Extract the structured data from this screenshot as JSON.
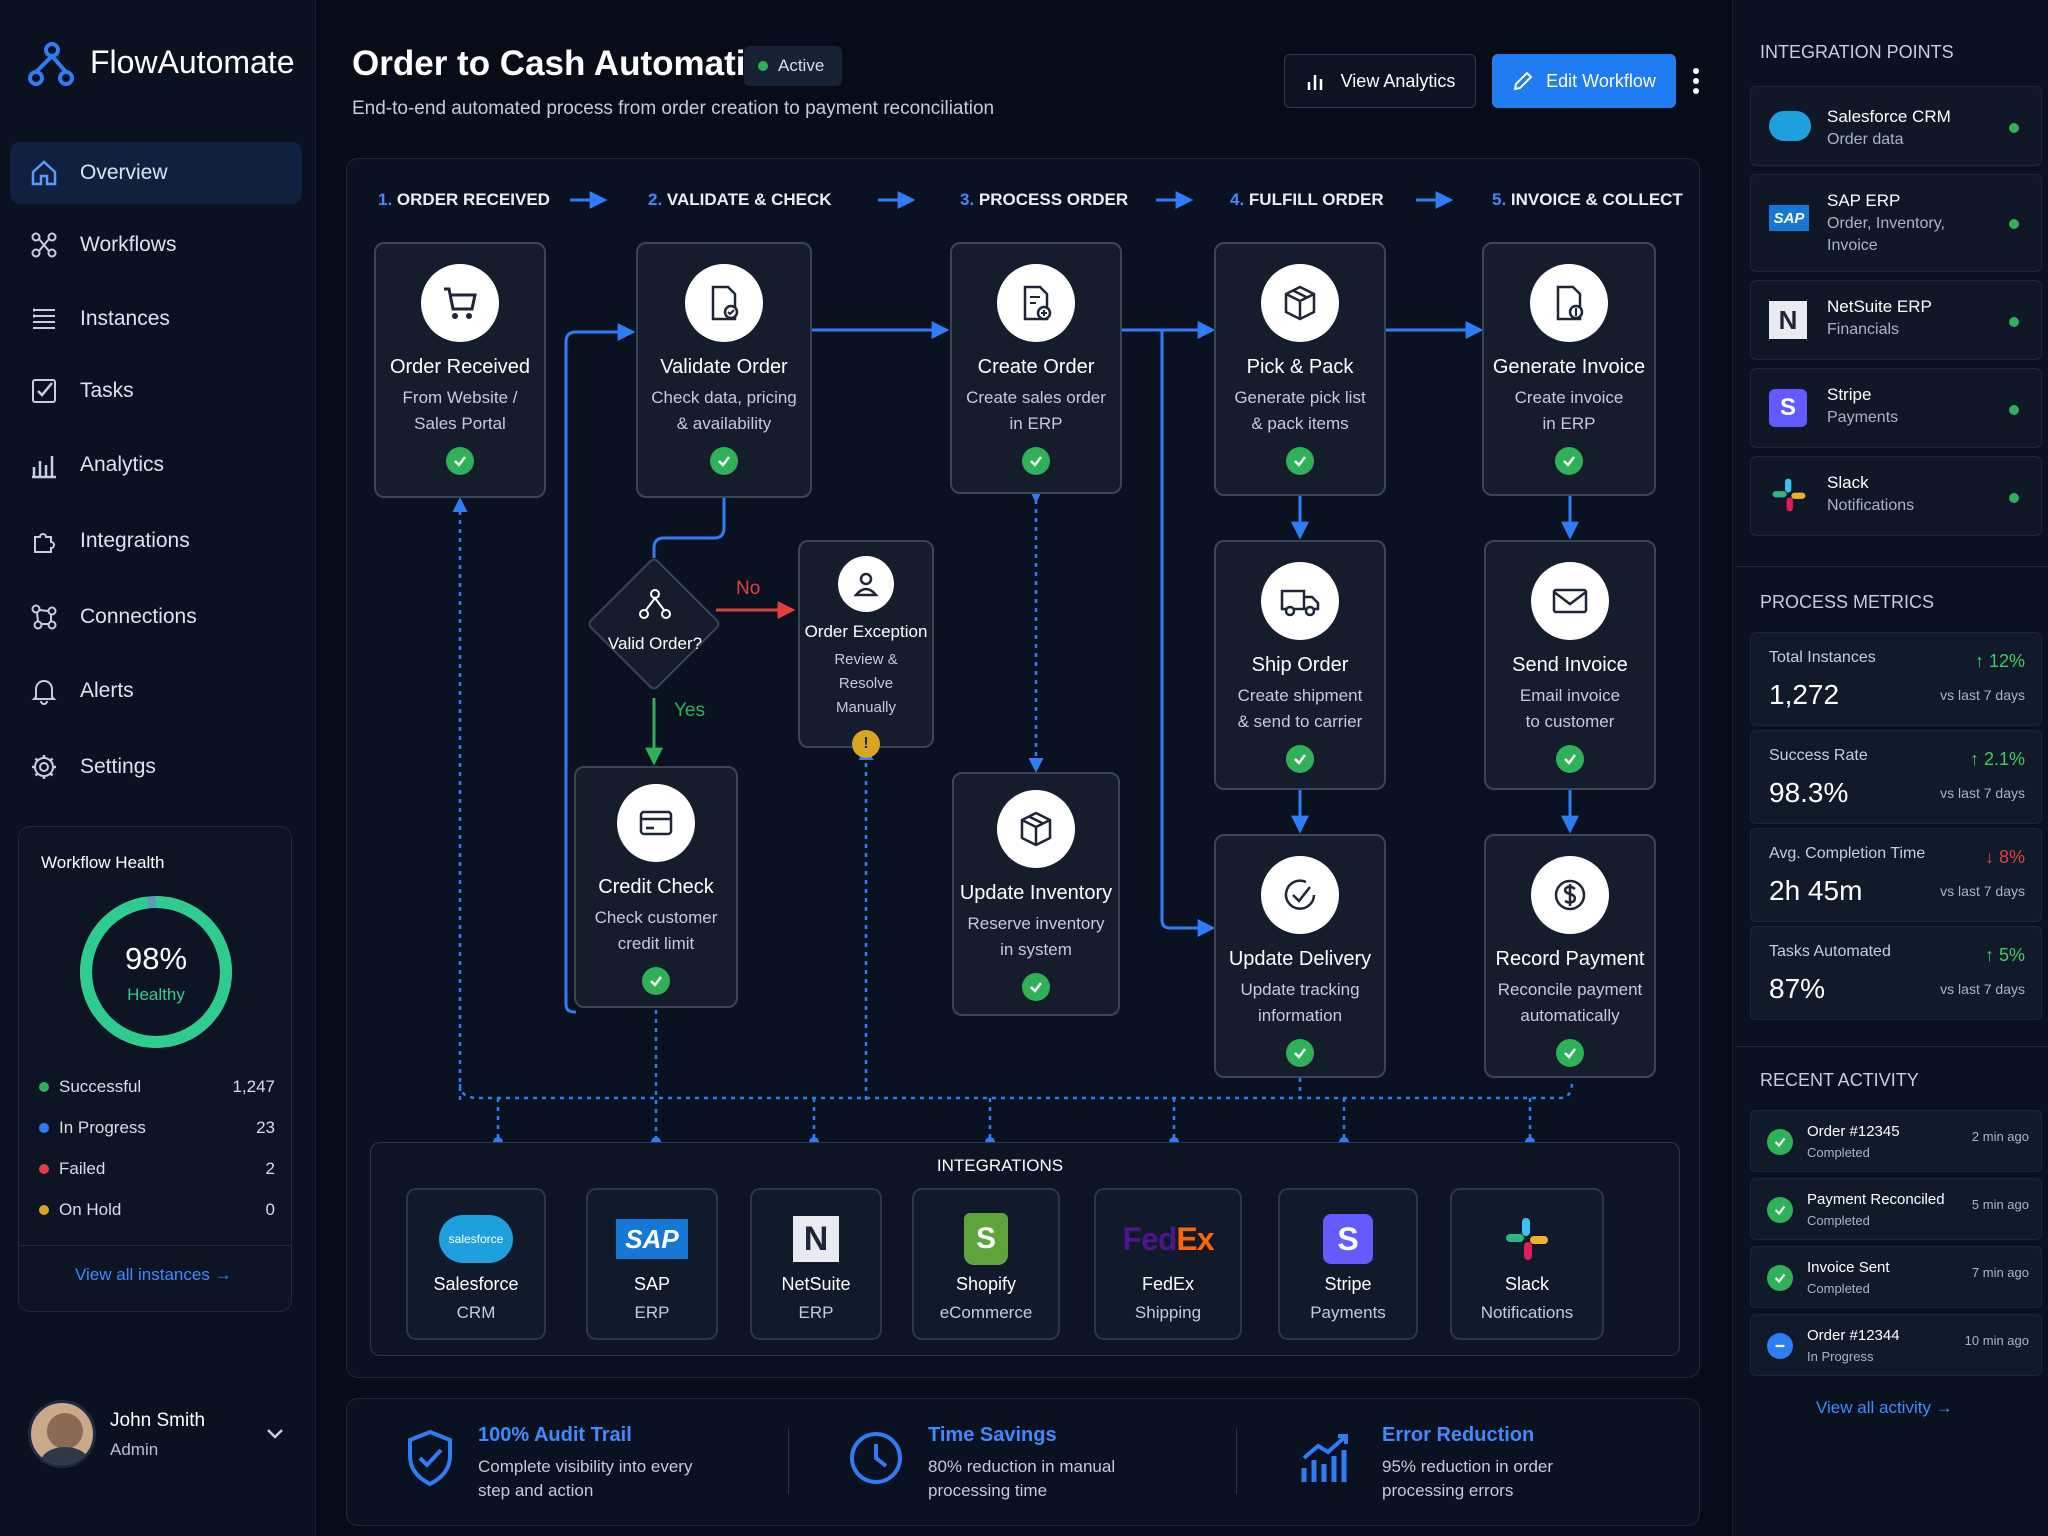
{
  "app": {
    "name": "FlowAutomate"
  },
  "nav": [
    {
      "label": "Overview",
      "icon": "home-icon"
    },
    {
      "label": "Workflows",
      "icon": "workflow-icon"
    },
    {
      "label": "Instances",
      "icon": "list-icon"
    },
    {
      "label": "Tasks",
      "icon": "check-square-icon"
    },
    {
      "label": "Analytics",
      "icon": "bar-chart-icon"
    },
    {
      "label": "Integrations",
      "icon": "puzzle-icon"
    },
    {
      "label": "Connections",
      "icon": "network-icon"
    },
    {
      "label": "Alerts",
      "icon": "bell-icon"
    },
    {
      "label": "Settings",
      "icon": "gear-icon"
    }
  ],
  "health": {
    "title": "Workflow Health",
    "percent_label": "98%",
    "status": "Healthy",
    "percent": 0.98,
    "items": [
      {
        "label": "Successful",
        "value": "1,247",
        "color": "#2fb157"
      },
      {
        "label": "In Progress",
        "value": "23",
        "color": "#2f7df6"
      },
      {
        "label": "Failed",
        "value": "2",
        "color": "#e0413c"
      },
      {
        "label": "On Hold",
        "value": "0",
        "color": "#d9a520"
      }
    ],
    "link": "View all instances"
  },
  "user": {
    "name": "John Smith",
    "role": "Admin"
  },
  "header": {
    "title": "Order to Cash Automation",
    "badge": "Active",
    "subtitle": "End-to-end automated process from order creation to payment reconciliation",
    "analytics_button": "View Analytics",
    "edit_button": "Edit Workflow"
  },
  "stages": [
    {
      "num": "1.",
      "label": "ORDER RECEIVED"
    },
    {
      "num": "2.",
      "label": "VALIDATE & CHECK"
    },
    {
      "num": "3.",
      "label": "PROCESS ORDER"
    },
    {
      "num": "4.",
      "label": "FULFILL ORDER"
    },
    {
      "num": "5.",
      "label": "INVOICE & COLLECT"
    }
  ],
  "nodes": {
    "order_received": {
      "title": "Order Received",
      "line1": "From Website /",
      "line2": "Sales Portal"
    },
    "validate_order": {
      "title": "Validate Order",
      "line1": "Check data, pricing",
      "line2": "& availability"
    },
    "create_order": {
      "title": "Create Order",
      "line1": "Create sales order",
      "line2": "in ERP"
    },
    "pick_pack": {
      "title": "Pick & Pack",
      "line1": "Generate pick list",
      "line2": "& pack items"
    },
    "generate_invoice": {
      "title": "Generate Invoice",
      "line1": "Create invoice",
      "line2": "in ERP"
    },
    "decision": {
      "label": "Valid Order?",
      "no": "No",
      "yes": "Yes"
    },
    "order_exception": {
      "title": "Order Exception",
      "line1": "Review & Resolve",
      "line2": "Manually"
    },
    "credit_check": {
      "title": "Credit Check",
      "line1": "Check customer",
      "line2": "credit limit"
    },
    "update_inventory": {
      "title": "Update Inventory",
      "line1": "Reserve inventory",
      "line2": "in system"
    },
    "ship_order": {
      "title": "Ship Order",
      "line1": "Create shipment",
      "line2": "& send to carrier"
    },
    "update_delivery": {
      "title": "Update Delivery",
      "line1": "Update tracking",
      "line2": "information"
    },
    "send_invoice": {
      "title": "Send Invoice",
      "line1": "Email invoice",
      "line2": "to customer"
    },
    "record_payment": {
      "title": "Record Payment",
      "line1": "Reconcile payment",
      "line2": "automatically"
    }
  },
  "integrations": {
    "title": "INTEGRATIONS",
    "items": [
      {
        "name": "Salesforce",
        "type": "CRM",
        "logo_text": "salesforce"
      },
      {
        "name": "SAP",
        "type": "ERP",
        "logo_text": "SAP"
      },
      {
        "name": "NetSuite",
        "type": "ERP",
        "logo_text": "N"
      },
      {
        "name": "Shopify",
        "type": "eCommerce",
        "logo_text": "S"
      },
      {
        "name": "FedEx",
        "type": "Shipping",
        "logo_text": "FedEx"
      },
      {
        "name": "Stripe",
        "type": "Payments",
        "logo_text": "S"
      },
      {
        "name": "Slack",
        "type": "Notifications"
      }
    ]
  },
  "benefits": [
    {
      "title": "100% Audit Trail",
      "line1": "Complete visibility into every",
      "line2": "step and action",
      "icon": "shield-check-icon"
    },
    {
      "title": "Time Savings",
      "line1": "80% reduction in manual",
      "line2": "processing time",
      "icon": "clock-icon"
    },
    {
      "title": "Error Reduction",
      "line1": "95% reduction in order",
      "line2": "processing errors",
      "icon": "trend-up-icon"
    }
  ],
  "integration_points": {
    "title": "INTEGRATION POINTS",
    "items": [
      {
        "name": "Salesforce CRM",
        "desc": "Order data",
        "desc2": ""
      },
      {
        "name": "SAP ERP",
        "desc": "Order, Inventory,",
        "desc2": "Invoice"
      },
      {
        "name": "NetSuite ERP",
        "desc": "Financials",
        "desc2": ""
      },
      {
        "name": "Stripe",
        "desc": "Payments",
        "desc2": ""
      },
      {
        "name": "Slack",
        "desc": "Notifications",
        "desc2": ""
      }
    ]
  },
  "metrics": {
    "title": "PROCESS METRICS",
    "items": [
      {
        "label": "Total Instances",
        "value": "1,272",
        "change": "↑ 12%",
        "sub": "vs last 7 days",
        "color": "#3ccf5f"
      },
      {
        "label": "Success Rate",
        "value": "98.3%",
        "change": "↑ 2.1%",
        "sub": "vs last 7 days",
        "color": "#3ccf5f"
      },
      {
        "label": "Avg. Completion Time",
        "value": "2h 45m",
        "change": "↓ 8%",
        "sub": "vs last 7 days",
        "color": "#e0413c"
      },
      {
        "label": "Tasks Automated",
        "value": "87%",
        "change": "↑ 5%",
        "sub": "vs last 7 days",
        "color": "#3ccf5f"
      }
    ]
  },
  "activity": {
    "title": "RECENT ACTIVITY",
    "items": [
      {
        "title": "Order #12345",
        "status": "Completed",
        "time": "2 min ago",
        "state": "done"
      },
      {
        "title": "Payment Reconciled",
        "status": "Completed",
        "time": "5 min ago",
        "state": "done"
      },
      {
        "title": "Invoice Sent",
        "status": "Completed",
        "time": "7 min ago",
        "state": "done"
      },
      {
        "title": "Order #12344",
        "status": "In Progress",
        "time": "10 min ago",
        "state": "progress"
      }
    ],
    "link": "View all activity"
  }
}
